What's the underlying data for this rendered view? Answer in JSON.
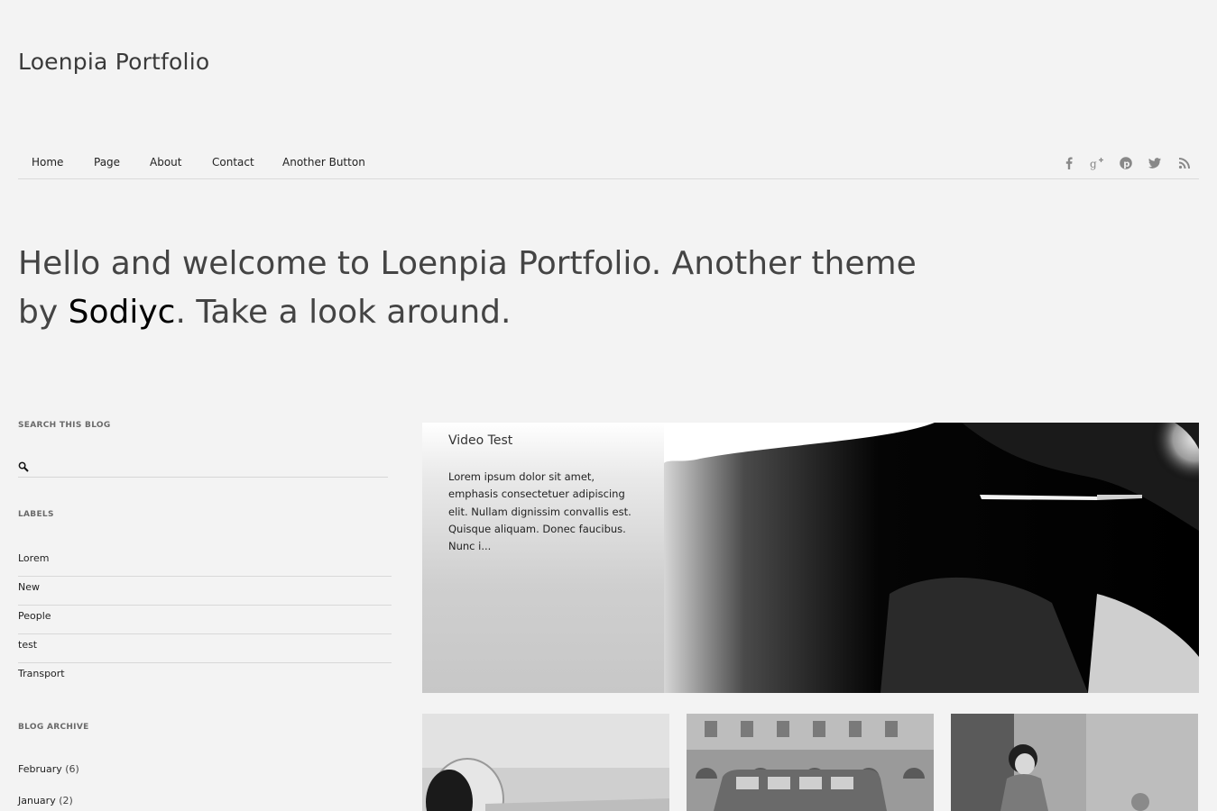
{
  "header": {
    "site_title": "Loenpia Portfolio"
  },
  "nav": {
    "items": [
      {
        "label": "Home"
      },
      {
        "label": "Page"
      },
      {
        "label": "About"
      },
      {
        "label": "Contact"
      },
      {
        "label": "Another Button"
      }
    ],
    "social_icons": [
      "facebook-icon",
      "google-plus-icon",
      "pinterest-icon",
      "twitter-icon",
      "rss-icon"
    ]
  },
  "hero": {
    "text_before": "Hello and welcome to Loenpia Portfolio. Another theme by",
    "link_text": "Sodiyc",
    "text_after": ". Take a look around."
  },
  "sidebar": {
    "search": {
      "title": "SEARCH THIS BLOG",
      "placeholder": "",
      "value": ""
    },
    "labels": {
      "title": "LABELS",
      "items": [
        "Lorem",
        "New",
        "People",
        "test",
        "Transport"
      ]
    },
    "archive": {
      "title": "BLOG ARCHIVE",
      "items": [
        {
          "month": "February",
          "count": "(6)"
        },
        {
          "month": "January",
          "count": "(2)"
        }
      ]
    }
  },
  "featured": {
    "title": "Video Test",
    "excerpt": "Lorem ipsum dolor sit amet, emphasis consectetuer adipiscing elit. Nullam dignissim convallis est. Quisque aliquam. Donec faucibus. Nunc i..."
  },
  "colors": {
    "background": "#f3f3f3",
    "text": "#333333",
    "rule": "#dadada"
  }
}
